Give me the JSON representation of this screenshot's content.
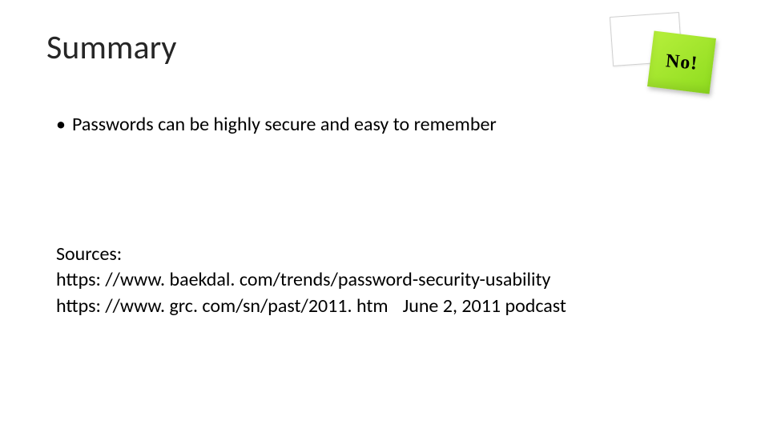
{
  "title": "Summary",
  "bullets": [
    "Passwords can be highly secure and easy to remember"
  ],
  "sources": {
    "heading": "Sources:",
    "items": [
      {
        "url": "https: //www. baekdal. com/trends/password-security-usability",
        "note": ""
      },
      {
        "url": "https: //www. grc. com/sn/past/2011. htm",
        "note": "June 2, 2011 podcast"
      }
    ]
  },
  "sticky": {
    "text": "No!"
  }
}
